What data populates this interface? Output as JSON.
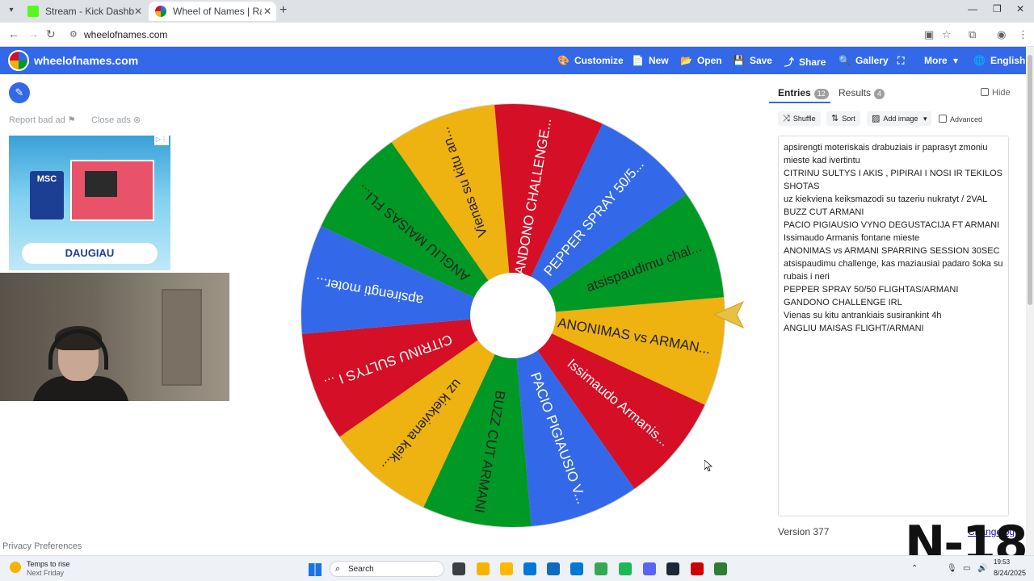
{
  "browser": {
    "tabs": [
      {
        "label": "Stream - Kick Dashboard",
        "favicon_color": "#53fc18"
      },
      {
        "label": "Wheel of Names | Random nam",
        "favicon_color": "#3369e8"
      }
    ],
    "url": "wheelofnames.com"
  },
  "header": {
    "brand": "wheelofnames.com",
    "buttons": [
      {
        "icon": "palette-icon",
        "glyph": "🎨",
        "label": "Customize"
      },
      {
        "icon": "file-icon",
        "glyph": "📄",
        "label": "New"
      },
      {
        "icon": "folder-icon",
        "glyph": "📂",
        "label": "Open"
      },
      {
        "icon": "save-icon",
        "glyph": "💾",
        "label": "Save"
      },
      {
        "icon": "share-icon",
        "glyph": "⤴",
        "label": "Share"
      },
      {
        "icon": "search-icon",
        "glyph": "🔍",
        "label": "Gallery"
      },
      {
        "icon": "fullscreen-icon",
        "glyph": "⛶",
        "label": ""
      },
      {
        "icon": "chevron-down-icon",
        "glyph": "▾",
        "label": "More"
      },
      {
        "icon": "globe-icon",
        "glyph": "🌐",
        "label": "English"
      }
    ]
  },
  "left": {
    "report_ad": "Report bad ad",
    "close_ads": "Close ads",
    "ad_brand": "MSC",
    "ad_button": "DAUGIAU"
  },
  "wheel": {
    "colors": [
      "#eeb211",
      "#d50f25",
      "#3369e8",
      "#009925"
    ],
    "segments": [
      {
        "label": "ANONIMAS vs ARMAN...",
        "color": "#eeb211",
        "text_color": "#222"
      },
      {
        "label": "Issimaudo Armanis...",
        "color": "#d50f25",
        "text_color": "#fff"
      },
      {
        "label": "PACIO PIGIAUSIO V...",
        "color": "#3369e8",
        "text_color": "#fff"
      },
      {
        "label": "BUZZ CUT ARMANI",
        "color": "#009925",
        "text_color": "#222"
      },
      {
        "label": "uz kiekviena keik...",
        "color": "#eeb211",
        "text_color": "#222"
      },
      {
        "label": "CITRINU SULTYS I ...",
        "color": "#d50f25",
        "text_color": "#fff"
      },
      {
        "label": "apsirengti moter...",
        "color": "#3369e8",
        "text_color": "#fff"
      },
      {
        "label": "ANGLIU MAISAS FLI...",
        "color": "#009925",
        "text_color": "#222"
      },
      {
        "label": "Vienas su kitu an...",
        "color": "#eeb211",
        "text_color": "#222"
      },
      {
        "label": "GANDONO CHALLENGE...",
        "color": "#d50f25",
        "text_color": "#fff"
      },
      {
        "label": "PEPPER SPRAY 50/5...",
        "color": "#3369e8",
        "text_color": "#fff"
      },
      {
        "label": "atsispaudimu chal...",
        "color": "#009925",
        "text_color": "#222"
      }
    ]
  },
  "panel": {
    "tab_entries": "Entries",
    "entries_count": "12",
    "tab_results": "Results",
    "results_count": "4",
    "hide": "Hide",
    "shuffle": "Shuffle",
    "sort": "Sort",
    "add_image": "Add image",
    "advanced": "Advanced",
    "entries_lines": [
      "apsirengti moteriskais drabuziais ir paprasyt zmoniu",
      "mieste kad ivertintu",
      "CITRINU SULTYS I AKIS , PIPIRAI I NOSI IR TEKILOS",
      "SHOTAS",
      "uz kiekviena keiksmazodi su tazeriu nukratyt / 2VAL",
      "BUZZ CUT ARMANI",
      "PACIO PIGIAUSIO VYNO DEGUSTACIJA FT ARMANI",
      "Issimaudo Armanis fontane mieste",
      "ANONIMAS vs ARMANI SPARRING SESSION 30SEC",
      "atsispaudimu challenge, kas maziausiai padaro šoka su",
      "rubais i neri",
      "PEPPER SPRAY 50/50 FLIGHTAS/ARMANI",
      "GANDONO CHALLENGE IRL",
      "Vienas su kitu antrankiais susirankint 4h",
      "ANGLIU MAISAS FLIGHT/ARMANI"
    ],
    "version": "Version 377",
    "changelog": "Changelog"
  },
  "privacy": "Privacy Preferences",
  "watermark": "N-18",
  "taskbar": {
    "weather_line1": "Temps to rise",
    "weather_line2": "Next Friday",
    "search": "Search",
    "date": "8/24/2025",
    "time": "19:53",
    "apps": [
      "#f4b400",
      "#ffb900",
      "#0078d4",
      "#0f6cbd",
      "#0078d4",
      "#34a853",
      "#1db954",
      "#5865f2",
      "#1b2838",
      "#c00",
      "#2e7d32"
    ]
  }
}
